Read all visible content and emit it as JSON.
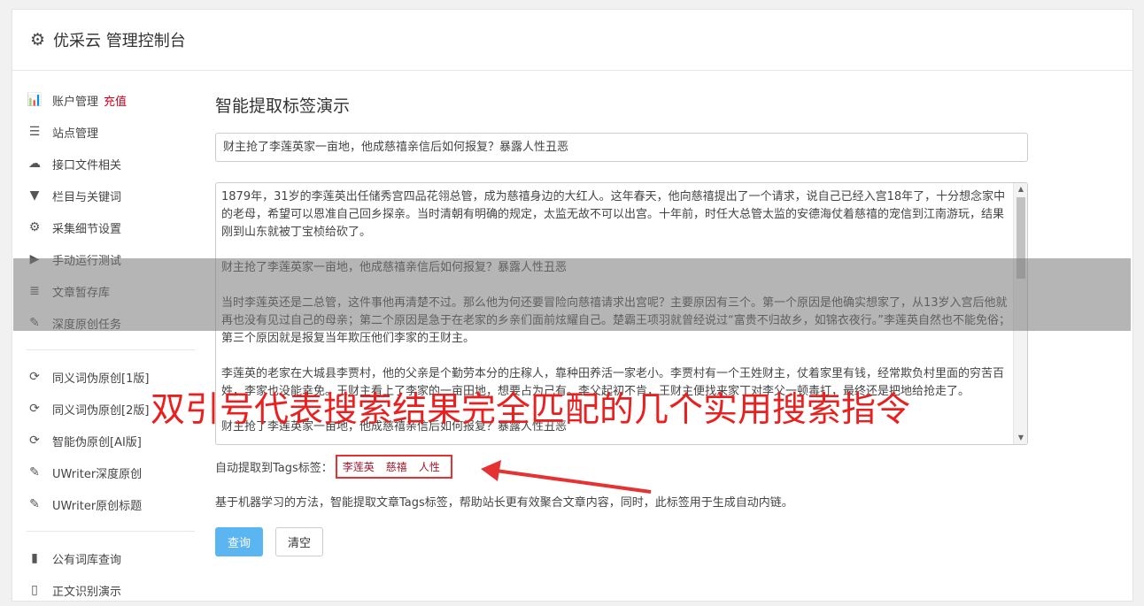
{
  "header": {
    "icon": "gear-icon",
    "title": "优采云 管理控制台"
  },
  "sidebar": {
    "group1": [
      {
        "icon": "bar-chart-icon",
        "glyph": "📊",
        "label": "账户管理",
        "extra": "充值"
      },
      {
        "icon": "server-icon",
        "glyph": "☰",
        "label": "站点管理"
      },
      {
        "icon": "cloud-upload-icon",
        "glyph": "☁",
        "label": "接口文件相关"
      },
      {
        "icon": "filter-icon",
        "glyph": "▼",
        "label": "栏目与关键词"
      },
      {
        "icon": "cogs-icon",
        "glyph": "⚙",
        "label": "采集细节设置"
      },
      {
        "icon": "play-circle-icon",
        "glyph": "▶",
        "label": "手动运行测试"
      },
      {
        "icon": "database-icon",
        "glyph": "≣",
        "label": "文章暂存库"
      },
      {
        "icon": "edit-icon",
        "glyph": "✎",
        "label": "深度原创任务"
      }
    ],
    "group2": [
      {
        "icon": "refresh-icon",
        "glyph": "⟳",
        "label": "同义词伪原创[1版]"
      },
      {
        "icon": "refresh-icon",
        "glyph": "⟳",
        "label": "同义词伪原创[2版]"
      },
      {
        "icon": "refresh-icon",
        "glyph": "⟳",
        "label": "智能伪原创[AI版]"
      },
      {
        "icon": "edit-icon",
        "glyph": "✎",
        "label": "UWriter深度原创"
      },
      {
        "icon": "edit-icon",
        "glyph": "✎",
        "label": "UWriter原创标题"
      }
    ],
    "group3": [
      {
        "icon": "book-icon",
        "glyph": "▮",
        "label": "公有词库查询"
      },
      {
        "icon": "document-icon",
        "glyph": "▯",
        "label": "正文识别演示"
      }
    ]
  },
  "main": {
    "heading": "智能提取标签演示",
    "title_value": "财主抢了李莲英家一亩地，他成慈禧亲信后如何报复？暴露人性丑恶",
    "paragraphs": [
      "1879年，31岁的李莲英出任储秀宫四品花翎总管，成为慈禧身边的大红人。这年春天，他向慈禧提出了一个请求，说自己已经入宫18年了，十分想念家中的老母，希望可以恩准自己回乡探亲。当时清朝有明确的规定，太监无故不可以出宫。十年前，时任大总管太监的安德海仗着慈禧的宠信到江南游玩，结果刚到山东就被丁宝桢给砍了。",
      "财主抢了李莲英家一亩地，他成慈禧亲信后如何报复？暴露人性丑恶",
      "当时李莲英还是二总管，这件事他再清楚不过。那么他为何还要冒险向慈禧请求出宫呢？主要原因有三个。第一个原因是他确实想家了，从13岁入宫后他就再也没有见过自己的母亲；第二个原因是急于在老家的乡亲们面前炫耀自己。楚霸王项羽就曾经说过“富贵不归故乡，如锦衣夜行。”李莲英自然也不能免俗；第三个原因就是报复当年欺压他们李家的王财主。",
      "李莲英的老家在大城县李贾村，他的父亲是个勤劳本分的庄稼人，靠种田养活一家老小。李贾村有一个王姓财主，仗着家里有钱，经常欺负村里面的穷苦百姓，李家也没能幸免。王财主看上了李家的一亩田地，想要占为己有。李父起初不肯，王财主便找来家丁对李父一顿毒打，最终还是把地给抢走了。",
      "财主抢了李莲英家一亩地，他成慈禧亲信后如何报复？暴露人性丑恶"
    ],
    "tags_label": "自动提取到Tags标签：",
    "tags": [
      "李莲英",
      "慈禧",
      "人性"
    ],
    "description": "基于机器学习的方法，智能提取文章Tags标签，帮助站长更有效聚合文章内容，同时，此标签用于生成自动内链。",
    "query_button": "查询",
    "clear_button": "清空"
  },
  "overlay": {
    "caption": "双引号代表搜索结果完全匹配的几个实用搜索指令"
  },
  "colors": {
    "accent": "#5bb5f0",
    "highlight": "#e53333",
    "tag": "#a0162c",
    "recharge": "#d9001b"
  }
}
